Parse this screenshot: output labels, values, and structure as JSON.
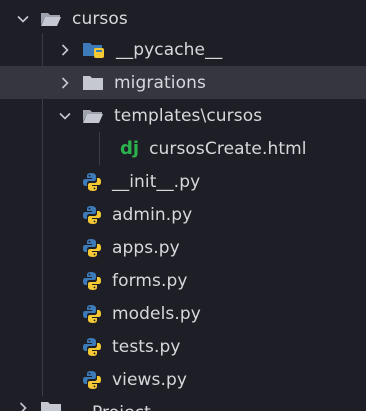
{
  "tree": {
    "root": {
      "label": "cursos",
      "expanded": true
    },
    "items": [
      {
        "label": "__pycache__",
        "kind": "folder-python",
        "expanded": false
      },
      {
        "label": "migrations",
        "kind": "folder",
        "expanded": false,
        "selected": true
      },
      {
        "label": "templates\\cursos",
        "kind": "folder",
        "expanded": true
      },
      {
        "label": "cursosCreate.html",
        "kind": "django-template"
      },
      {
        "label": "__init__.py",
        "kind": "python-file"
      },
      {
        "label": "admin.py",
        "kind": "python-file"
      },
      {
        "label": "apps.py",
        "kind": "python-file"
      },
      {
        "label": "forms.py",
        "kind": "python-file"
      },
      {
        "label": "models.py",
        "kind": "python-file"
      },
      {
        "label": "tests.py",
        "kind": "python-file"
      },
      {
        "label": "views.py",
        "kind": "python-file"
      }
    ],
    "next_partial": {
      "label": "Project",
      "kind": "folder"
    }
  },
  "colors": {
    "background": "#1e1f26",
    "selected": "#35363f",
    "text": "#d6d8dd",
    "folder": "#c5c8d0",
    "python_blue": "#3d7ab8",
    "python_yellow": "#f5c934",
    "django_green": "#2bb24c"
  },
  "icons": {
    "chevron_down": "chevron-down-icon",
    "chevron_right": "chevron-right-icon",
    "folder": "folder-icon",
    "folder_open": "folder-open-icon",
    "python_folder": "python-folder-icon",
    "python": "python-icon",
    "django": "django-icon"
  }
}
